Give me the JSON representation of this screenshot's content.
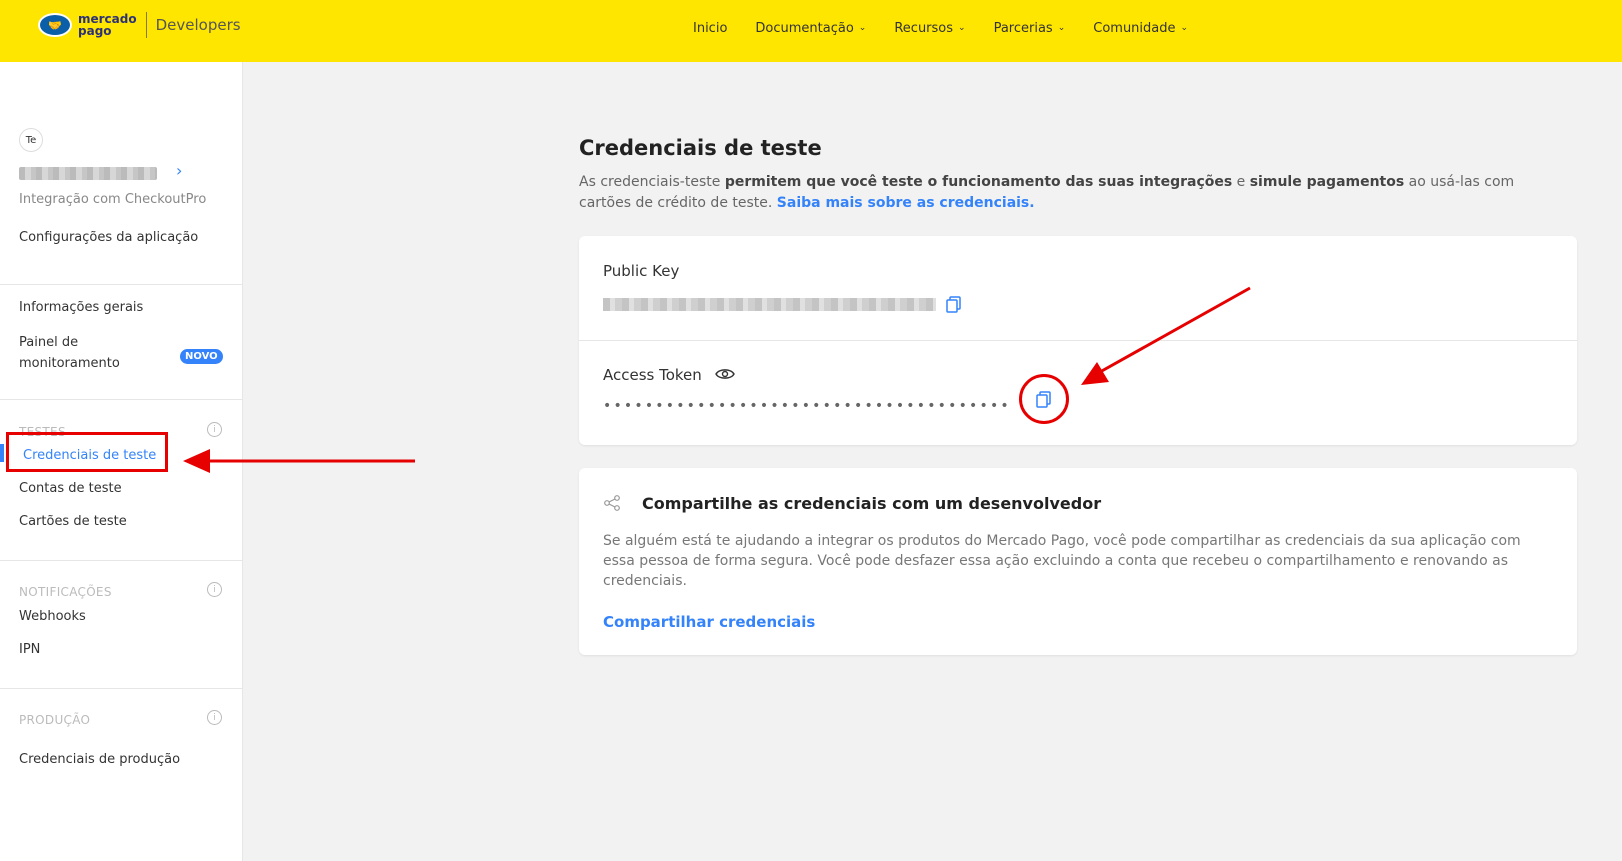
{
  "header": {
    "logo_line1": "mercado",
    "logo_line2": "pago",
    "logo_product": "Developers",
    "nav": [
      {
        "label": "Inicio",
        "has_dropdown": false
      },
      {
        "label": "Documentação",
        "has_dropdown": true
      },
      {
        "label": "Recursos",
        "has_dropdown": true
      },
      {
        "label": "Parcerias",
        "has_dropdown": true
      },
      {
        "label": "Comunidade",
        "has_dropdown": true
      }
    ]
  },
  "sidebar": {
    "avatar_initials": "Te",
    "app_subtitle": "Integração com CheckoutPro",
    "app_settings": "Configurações da aplicação",
    "general_info": "Informações gerais",
    "monitoring_line1": "Painel de",
    "monitoring_line2": "monitoramento",
    "badge_new": "NOVO",
    "section_tests": "TESTES",
    "test_credentials": "Credenciais de teste",
    "test_accounts": "Contas de teste",
    "test_cards": "Cartões de teste",
    "section_notifications": "NOTIFICAÇÕES",
    "webhooks": "Webhooks",
    "ipn": "IPN",
    "section_production": "PRODUÇÃO",
    "production_credentials": "Credenciais de produção"
  },
  "main": {
    "title": "Credenciais de teste",
    "desc_part1": "As credenciais-teste ",
    "desc_bold1": "permitem que você teste o funcionamento das suas integrações",
    "desc_part2": " e ",
    "desc_bold2": "simule pagamentos",
    "desc_part3": " ao usá-las com cartões de crédito de teste. ",
    "desc_link": "Saiba mais sobre as credenciais.",
    "public_key_label": "Public Key",
    "access_token_label": "Access Token",
    "access_token_masked": "•••••••••••••••••••••••••••••••••••••••",
    "share_title": "Compartilhe as credenciais com um desenvolvedor",
    "share_desc": "Se alguém está te ajudando a integrar os produtos do Mercado Pago, você pode compartilhar as credenciais da sua aplicação com essa pessoa de forma segura. Você pode desfazer essa ação excluindo a conta que recebeu o compartilhamento e renovando as credenciais.",
    "share_link": "Compartilhar credenciais"
  },
  "colors": {
    "header_bg": "#ffe600",
    "accent": "#3483fa",
    "annotation_red": "#e60000"
  }
}
